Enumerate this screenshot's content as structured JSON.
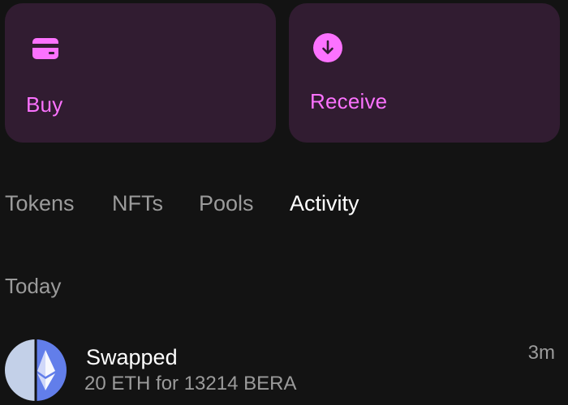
{
  "actions": {
    "buy": {
      "label": "Buy",
      "icon": "credit-card-icon"
    },
    "receive": {
      "label": "Receive",
      "icon": "arrow-down-circle-icon"
    }
  },
  "tabs": [
    {
      "label": "Tokens",
      "active": false
    },
    {
      "label": "NFTs",
      "active": false
    },
    {
      "label": "Pools",
      "active": false
    },
    {
      "label": "Activity",
      "active": true
    }
  ],
  "activity": {
    "section_label": "Today",
    "items": [
      {
        "title": "Swapped",
        "subtitle": "20 ETH for 13214 BERA",
        "time": "3m",
        "icon": "eth-bera-pair-icon"
      }
    ]
  },
  "colors": {
    "background": "#131313",
    "card": "#311c31",
    "accent": "#fc72ff",
    "text_primary": "#ffffff",
    "text_secondary": "#9b9b9b",
    "eth_blue": "#627eea"
  }
}
